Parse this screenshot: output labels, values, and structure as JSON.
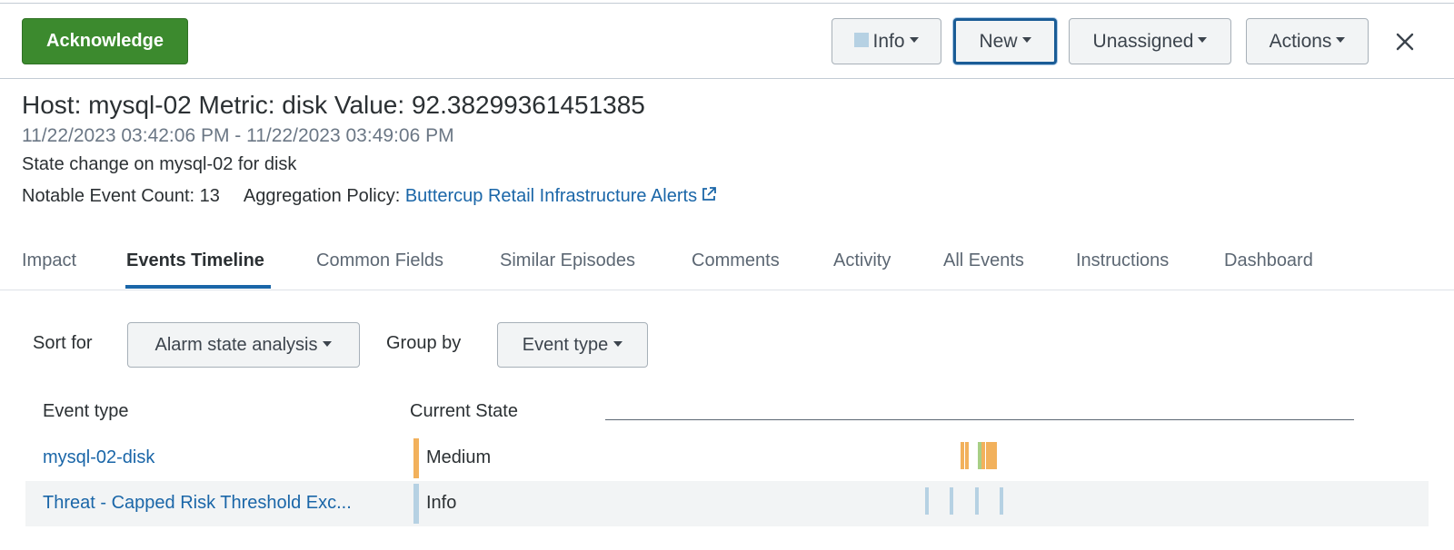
{
  "header": {
    "acknowledge_label": "Acknowledge",
    "severity_label": "Info",
    "status_label": "New",
    "owner_label": "Unassigned",
    "actions_label": "Actions",
    "severity_swatch_color": "#b6d1e3"
  },
  "episode": {
    "title": "Host: mysql-02 Metric: disk Value: 92.38299361451385",
    "time_range": "11/22/2023 03:42:06 PM - 11/22/2023 03:49:06 PM",
    "description": "State change on mysql-02 for disk",
    "event_count_label": "Notable Event Count: 13",
    "policy_label": "Aggregation Policy:",
    "policy_link": "Buttercup Retail Infrastructure Alerts"
  },
  "tabs": [
    {
      "label": "Impact",
      "active": false
    },
    {
      "label": "Events Timeline",
      "active": true
    },
    {
      "label": "Common Fields",
      "active": false
    },
    {
      "label": "Similar Episodes",
      "active": false
    },
    {
      "label": "Comments",
      "active": false
    },
    {
      "label": "Activity",
      "active": false
    },
    {
      "label": "All Events",
      "active": false
    },
    {
      "label": "Instructions",
      "active": false
    },
    {
      "label": "Dashboard",
      "active": false
    }
  ],
  "controls": {
    "sort_label": "Sort for",
    "sort_value": "Alarm state analysis",
    "group_label": "Group by",
    "group_value": "Event type"
  },
  "timeline": {
    "columns": [
      "Event type",
      "Current State"
    ],
    "rows": [
      {
        "event_type": "mysql-02-disk",
        "state": "Medium",
        "state_color": "#f2b15c",
        "ticks": [
          {
            "pos": 0.474,
            "color": "#f2b15c"
          },
          {
            "pos": 0.48,
            "color": "#f2b15c"
          },
          {
            "pos": 0.498,
            "color": "#a8cf86"
          },
          {
            "pos": 0.503,
            "color": "#f2b15c"
          },
          {
            "pos": 0.508,
            "color": "#f2b15c"
          },
          {
            "pos": 0.513,
            "color": "#f2b15c"
          },
          {
            "pos": 0.518,
            "color": "#f2b15c"
          }
        ]
      },
      {
        "event_type": "Threat - Capped Risk Threshold Exc...",
        "state": "Info",
        "state_color": "#b6d1e3",
        "ticks": [
          {
            "pos": 0.427,
            "color": "#b6d1e3"
          },
          {
            "pos": 0.46,
            "color": "#b6d1e3"
          },
          {
            "pos": 0.494,
            "color": "#b6d1e3"
          },
          {
            "pos": 0.527,
            "color": "#b6d1e3"
          }
        ]
      }
    ]
  }
}
